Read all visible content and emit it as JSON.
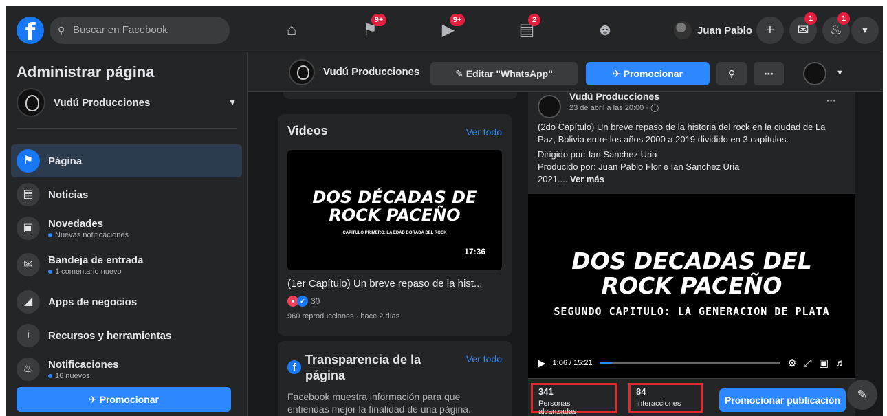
{
  "topbar": {
    "search_placeholder": "Buscar en Facebook",
    "badges": {
      "pages": "9+",
      "watch": "9+",
      "marketplace": "2",
      "messenger": "1",
      "notifications": "1"
    },
    "user_name": "Juan Pablo",
    "create_label": "+"
  },
  "sidebar": {
    "title": "Administrar página",
    "page_name": "Vudú Producciones",
    "items": [
      {
        "label": "Página",
        "sub": ""
      },
      {
        "label": "Noticias",
        "sub": ""
      },
      {
        "label": "Novedades",
        "sub": "Nuevas notificaciones"
      },
      {
        "label": "Bandeja de entrada",
        "sub": "1 comentario nuevo"
      },
      {
        "label": "Apps de negocios",
        "sub": ""
      },
      {
        "label": "Recursos y herramientas",
        "sub": ""
      },
      {
        "label": "Notificaciones",
        "sub": "16 nuevos"
      }
    ],
    "promote_label": "Promocionar"
  },
  "pagebar": {
    "page_name": "Vudú Producciones",
    "edit_label": "Editar \"WhatsApp\"",
    "promote_label": "Promocionar"
  },
  "videos_card": {
    "title": "Videos",
    "see_all": "Ver todo",
    "thumb_title_line1": "DOS DÉCADAS DE",
    "thumb_title_line2": "ROCK PACEÑO",
    "thumb_subtitle": "CAPITULO PRIMERO: LA EDAD DORADA DEL ROCK",
    "duration": "17:36",
    "caption": "(1er Capítulo) Un breve repaso de la hist...",
    "reactions_count": "30",
    "meta": "960 reproducciones · hace 2 días"
  },
  "transparency_card": {
    "title": "Transparencia de la página",
    "see_all": "Ver todo",
    "description": "Facebook muestra información para que entiendas mejor la finalidad de una página."
  },
  "post": {
    "author": "Vudú Producciones",
    "date": "23 de abril a las 20:00 · ",
    "more": "···",
    "text_p1": "(2do Capítulo) Un breve repaso de la historia del rock en la ciudad de La Paz, Bolivia entre los años 2000 a 2019 dividido en 3 capítulos.",
    "text_line1": "Dirigido por: Ian Sanchez Uria",
    "text_line2": "Producido por: Juan Pablo Flor e Ian Sanchez Uria",
    "text_line3": "2021.... ",
    "see_more": "Ver más",
    "video_title_line1": "DOS DECADAS DEL",
    "video_title_line2": "ROCK PACEÑO",
    "video_subtitle": "SEGUNDO CAPITULO: LA GENERACION DE PLATA",
    "video_time": "1:06 / 15:21",
    "progress_fraction": 0.07
  },
  "stats": {
    "reach_value": "341",
    "reach_label": "Personas alcanzadas",
    "interactions_value": "84",
    "interactions_label": "Interacciones",
    "boost_label": "Promocionar publicación"
  }
}
